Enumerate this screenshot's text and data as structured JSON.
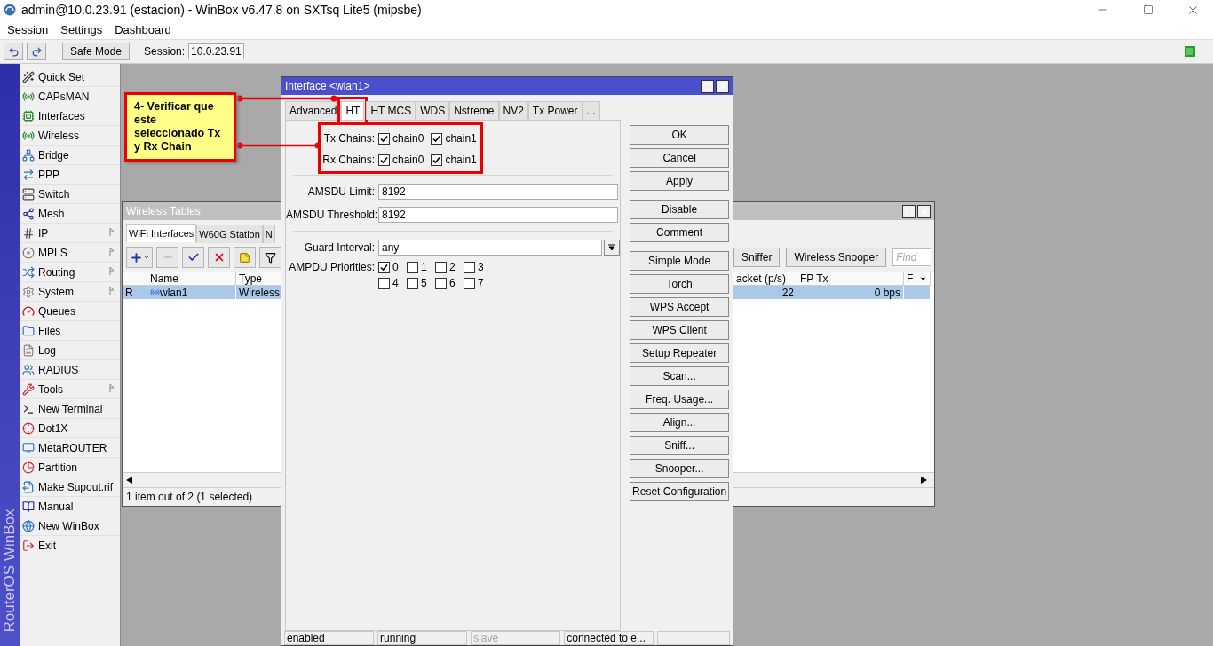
{
  "window": {
    "title": "admin@10.0.23.91 (estacion) - WinBox v6.47.8 on SXTsq Lite5 (mipsbe)"
  },
  "menu": [
    "Session",
    "Settings",
    "Dashboard"
  ],
  "toolbar": {
    "safe_mode": "Safe Mode",
    "session_label": "Session:",
    "session_value": "10.0.23.91"
  },
  "brand": "RouterOS WinBox",
  "sidebar": {
    "items": [
      {
        "label": "Quick Set",
        "submenu": false
      },
      {
        "label": "CAPsMAN",
        "submenu": false
      },
      {
        "label": "Interfaces",
        "submenu": false
      },
      {
        "label": "Wireless",
        "submenu": false
      },
      {
        "label": "Bridge",
        "submenu": false
      },
      {
        "label": "PPP",
        "submenu": false
      },
      {
        "label": "Switch",
        "submenu": false
      },
      {
        "label": "Mesh",
        "submenu": false
      },
      {
        "label": "IP",
        "submenu": true
      },
      {
        "label": "MPLS",
        "submenu": true
      },
      {
        "label": "Routing",
        "submenu": true
      },
      {
        "label": "System",
        "submenu": true
      },
      {
        "label": "Queues",
        "submenu": false
      },
      {
        "label": "Files",
        "submenu": false
      },
      {
        "label": "Log",
        "submenu": false
      },
      {
        "label": "RADIUS",
        "submenu": false
      },
      {
        "label": "Tools",
        "submenu": true
      },
      {
        "label": "New Terminal",
        "submenu": false
      },
      {
        "label": "Dot1X",
        "submenu": false
      },
      {
        "label": "MetaROUTER",
        "submenu": false
      },
      {
        "label": "Partition",
        "submenu": false
      },
      {
        "label": "Make Supout.rif",
        "submenu": false
      },
      {
        "label": "Manual",
        "submenu": false
      },
      {
        "label": "New WinBox",
        "submenu": false
      },
      {
        "label": "Exit",
        "submenu": false
      }
    ]
  },
  "wireless_tables": {
    "title": "Wireless Tables",
    "tabs": [
      {
        "label": "WiFi Interfaces",
        "selected": true
      },
      {
        "label": "W60G Station",
        "selected": false
      },
      {
        "label": "N",
        "selected": false
      }
    ],
    "buttons": [
      "Sniffer",
      "Wireless Snooper"
    ],
    "find": {
      "placeholder": "Find"
    },
    "columns": {
      "name": "Name",
      "type": "Type",
      "packets": "acket (p/s)",
      "fp_tx": "FP Tx",
      "column_6": "F"
    },
    "rows": [
      {
        "flag": "R",
        "name": "wlan1",
        "type": "Wireless",
        "packets": "22",
        "fp_tx": "0 bps",
        "selected": true
      }
    ],
    "status": "1 item out of 2 (1 selected)"
  },
  "dialog": {
    "title": "Interface <wlan1>",
    "tabs": [
      {
        "label": "Advanced",
        "selected": false
      },
      {
        "label": "HT",
        "selected": true
      },
      {
        "label": "HT MCS",
        "selected": false
      },
      {
        "label": "WDS",
        "selected": false
      },
      {
        "label": "Nstreme",
        "selected": false
      },
      {
        "label": "NV2",
        "selected": false
      },
      {
        "label": "Tx Power",
        "selected": false
      },
      {
        "label": "...",
        "selected": false
      }
    ],
    "tx_chains": {
      "label": "Tx Chains:",
      "options": [
        {
          "label": "chain0",
          "checked": true
        },
        {
          "label": "chain1",
          "checked": true
        }
      ]
    },
    "rx_chains": {
      "label": "Rx Chains:",
      "options": [
        {
          "label": "chain0",
          "checked": true
        },
        {
          "label": "chain1",
          "checked": true
        }
      ]
    },
    "amsdu_limit": {
      "label": "AMSDU Limit:",
      "value": "8192"
    },
    "amsdu_threshold": {
      "label": "AMSDU Threshold:",
      "value": "8192"
    },
    "guard_interval": {
      "label": "Guard Interval:",
      "value": "any"
    },
    "ampdu_priorities": {
      "label": "AMPDU Priorities:",
      "options": [
        {
          "label": "0",
          "checked": true
        },
        {
          "label": "1",
          "checked": false
        },
        {
          "label": "2",
          "checked": false
        },
        {
          "label": "3",
          "checked": false
        },
        {
          "label": "4",
          "checked": false
        },
        {
          "label": "5",
          "checked": false
        },
        {
          "label": "6",
          "checked": false
        },
        {
          "label": "7",
          "checked": false
        }
      ]
    },
    "button_groups": [
      [
        "OK",
        "Cancel",
        "Apply"
      ],
      [
        "Disable",
        "Comment"
      ],
      [
        "Simple Mode",
        "Torch",
        "WPS Accept",
        "WPS Client",
        "Setup Repeater",
        "Scan...",
        "Freq. Usage...",
        "Align...",
        "Sniff...",
        "Snooper...",
        "Reset Configuration"
      ]
    ],
    "status_bar": [
      {
        "text": "enabled",
        "disabled": false
      },
      {
        "text": "running",
        "disabled": false
      },
      {
        "text": "slave",
        "disabled": true
      },
      {
        "text": "connected to e...",
        "disabled": false
      }
    ]
  },
  "annotation": {
    "text": "4- Verificar que este seleccionado Tx y Rx Chain"
  }
}
